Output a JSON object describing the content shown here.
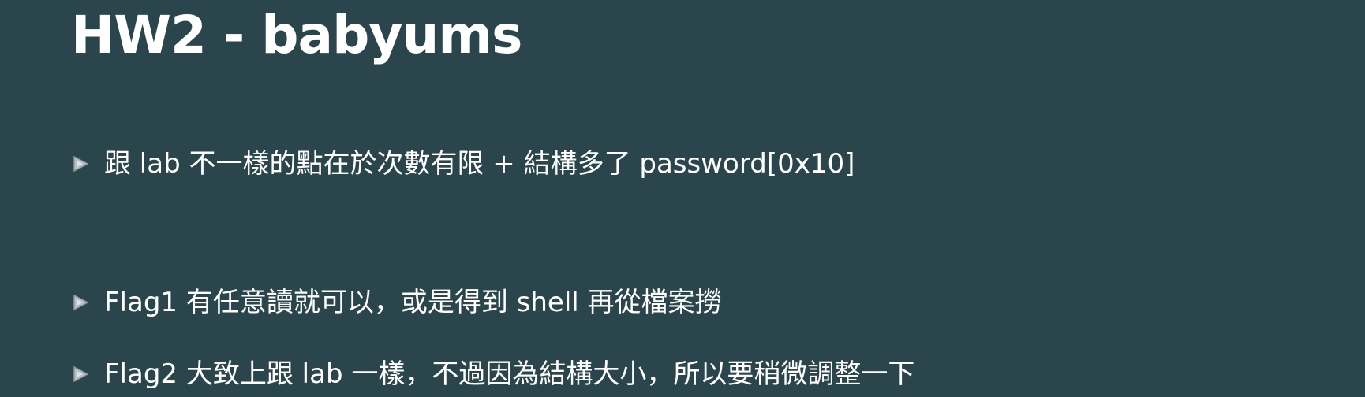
{
  "slide": {
    "title": "HW2 - babyums",
    "bullets": [
      {
        "text": "跟 lab 不一樣的點在於次數有限 + 結構多了 password[0x10]",
        "icon": "triangle-bullet-icon"
      },
      {
        "text": "Flag1 有任意讀就可以，或是得到 shell 再從檔案撈",
        "icon": "triangle-bullet-icon"
      },
      {
        "text": "Flag2 大致上跟 lab 一樣，不過因為結構大小，所以要稍微調整一下",
        "icon": "triangle-bullet-icon"
      }
    ]
  },
  "colors": {
    "background": "#2b454c",
    "text": "#ffffff",
    "bullet_icon": "#b8c2c6"
  }
}
